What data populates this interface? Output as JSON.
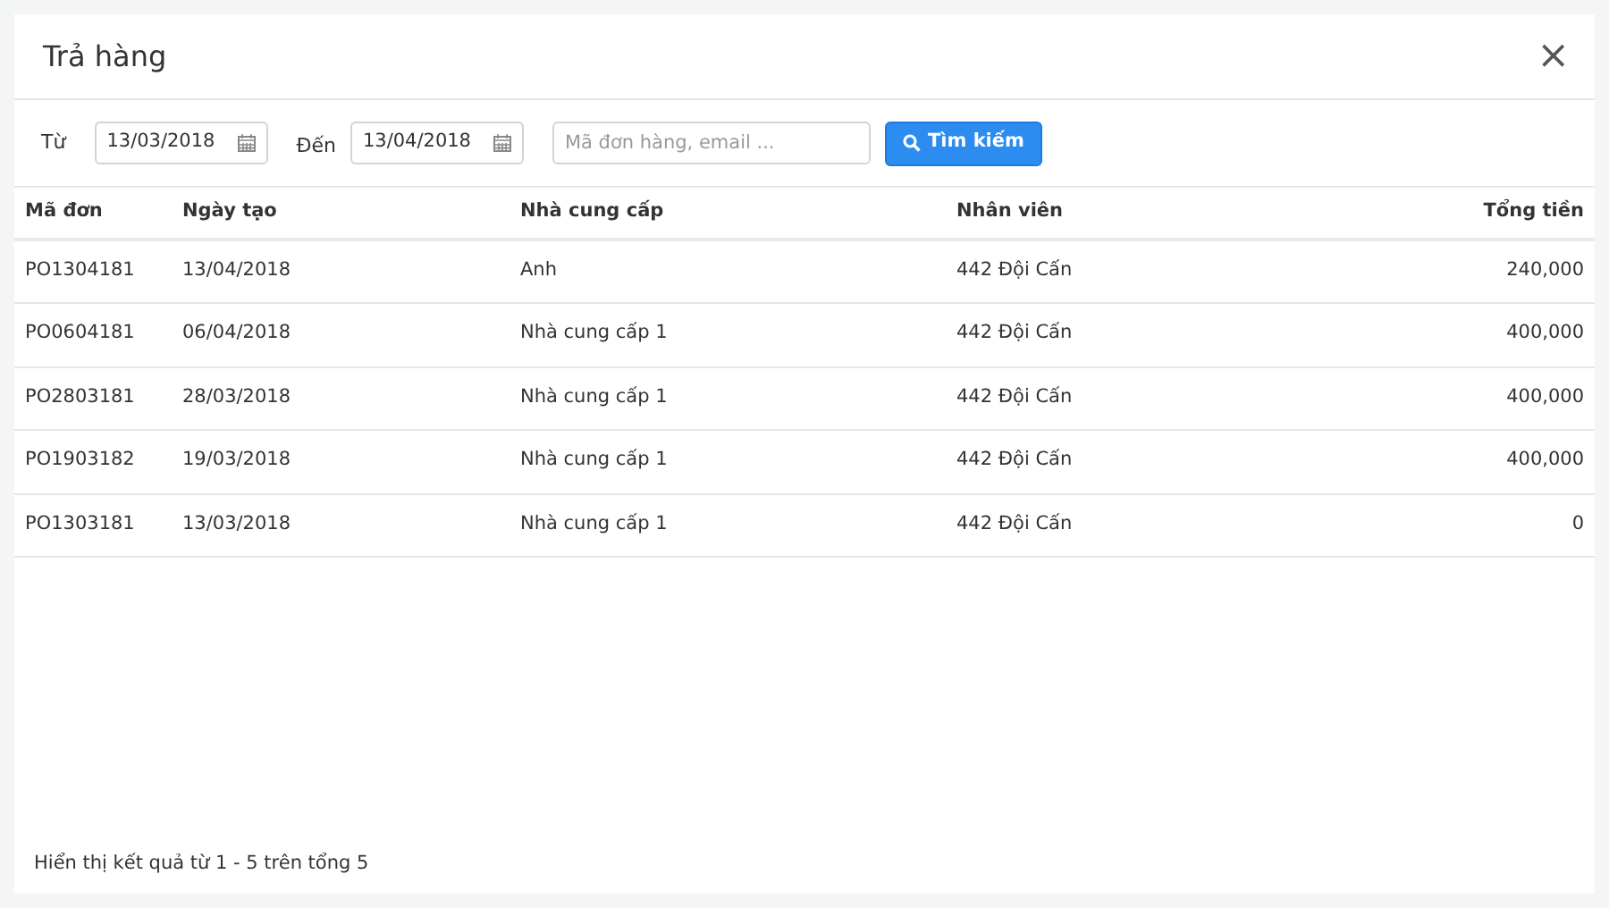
{
  "dialog": {
    "title": "Trả hàng",
    "close": "×"
  },
  "filters": {
    "from_label": "Từ",
    "from_value": "13/03/2018",
    "to_label": "Đến",
    "to_value": "13/04/2018",
    "search": {
      "placeholder": "Mã đơn hàng, email ..."
    },
    "search_button": "Tìm kiếm"
  },
  "table": {
    "columns": [
      "Mã đơn",
      "Ngày tạo",
      "Nhà cung cấp",
      "Nhân viên",
      "Tổng tiền"
    ],
    "rows": [
      [
        "PO1304181",
        "13/04/2018",
        "Anh",
        "442 Đội Cấn",
        "240,000"
      ],
      [
        "PO0604181",
        "06/04/2018",
        "Nhà cung cấp 1",
        "442 Đội Cấn",
        "400,000"
      ],
      [
        "PO2803181",
        "28/03/2018",
        "Nhà cung cấp 1",
        "442 Đội Cấn",
        "400,000"
      ],
      [
        "PO1903182",
        "19/03/2018",
        "Nhà cung cấp 1",
        "442 Đội Cấn",
        "400,000"
      ],
      [
        "PO1303181",
        "13/03/2018",
        "Nhà cung cấp 1",
        "442 Đội Cấn",
        "0"
      ]
    ]
  },
  "footer": "Hiển thị kết quả từ 1 - 5 trên tổng 5"
}
